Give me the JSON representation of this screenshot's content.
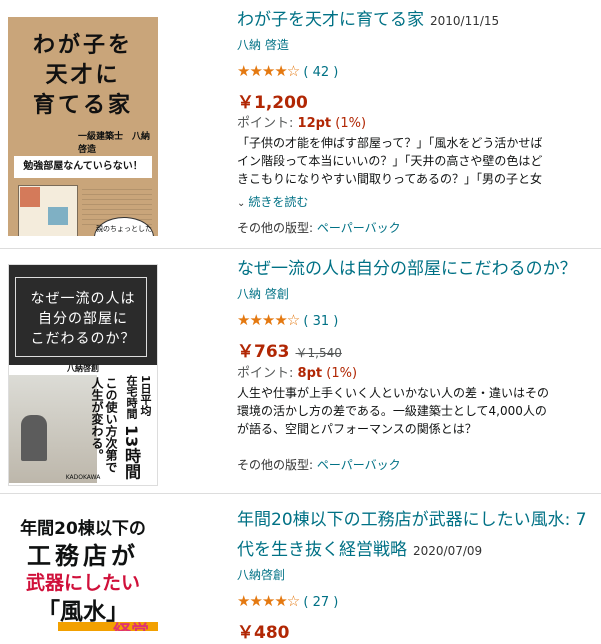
{
  "results": [
    {
      "title": "わが子を天才に育てる家",
      "date": "2010/11/15",
      "author": "八納 啓造",
      "stars": "★★★★☆",
      "rating_count": "42",
      "price": "￥1,200",
      "points_label": "ポイント:",
      "points_value": "12pt",
      "points_pct": "(1%)",
      "desc": [
        "「子供の才能を伸ばす部屋って？」「風水をどう活かせば",
        "イン階段って本当にいいの？」「天井の高さや壁の色はど",
        "きこもりになりやすい間取りってあるの？」「男の子と女"
      ],
      "read_more": "続きを読む",
      "other_label": "その他の版型:",
      "other_format": "ペーパーバック",
      "cover": {
        "title_lines": [
          "わが子を",
          "天才に",
          "育てる家"
        ],
        "author": "一級建築士　八納啓造",
        "banner": "勉強部屋なんていらない！",
        "bubble": "親のちょっとした工夫で"
      }
    },
    {
      "title": "なぜ一流の人は自分の部屋にこだわるのか？",
      "author": "八納 啓創",
      "stars": "★★★★☆",
      "rating_count": "31",
      "price": "￥763",
      "list_price": "￥1,540",
      "points_label": "ポイント:",
      "points_value": "8pt",
      "points_pct": "(1%)",
      "desc": [
        "人生や仕事が上手くいく人といかない人の差・違いはその",
        "環境の活かし方の差である。一級建築士として4,000人の",
        "が語る、空間とパフォーマンスの関係とは？"
      ],
      "other_label": "その他の版型:",
      "other_format": "ペーパーバック",
      "cover": {
        "title_lines": [
          "なぜ一流の人は",
          "自分の部屋に",
          "こだわるのか？"
        ],
        "author": "八納啓創",
        "vertical_text": [
          "1日平均",
          "在宅時間",
          "13時間",
          "この使い方次第で",
          "人生が変わる。"
        ],
        "publisher": "KADOKAWA"
      }
    },
    {
      "title": "年間20棟以下の工務店が武器にしたい風水: 7",
      "title_cont": "代を生き抜く経営戦略",
      "date": "2020/07/09",
      "author": "八納啓創",
      "stars": "★★★★☆",
      "rating_count": "27",
      "price": "￥480",
      "cover": {
        "lines": [
          "年間20棟以下の",
          "工務店が",
          "武器にしたい",
          "「風水」"
        ],
        "tag": "経営"
      }
    }
  ],
  "colors": {
    "link": "#007185",
    "price": "#B12704",
    "star": "#E47911"
  }
}
